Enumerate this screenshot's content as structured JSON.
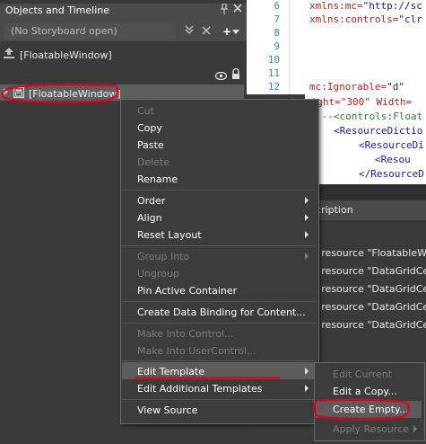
{
  "panel": {
    "title": "Objects and Timeline",
    "storyboard_placeholder": "(No Storyboard open)",
    "scope_label": "[FloatableWindow]",
    "tree_item": "[FloatableWindow]"
  },
  "editor": {
    "line_numbers": [
      "6",
      "7",
      "8",
      "9",
      "10",
      "11",
      "12"
    ],
    "lines": [
      {
        "a": "xmlns:mc=",
        "b": "\"http://sc"
      },
      {
        "a": "xmlns:controls=",
        "b": "\"clr"
      },
      {
        "a": "",
        "b": ""
      },
      {
        "a": "",
        "b": ""
      },
      {
        "a": "",
        "b": ""
      },
      {
        "a": "",
        "b": ""
      },
      {
        "a": "mc:Ignorable=",
        "b": "\"d\""
      }
    ],
    "lines2": [
      {
        "t": "eight=\"300\" Width=",
        "k": "attr"
      },
      {
        "t": "!--<controls:Float",
        "k": "comment"
      },
      {
        "t": "<ResourceDictio",
        "k": "tag"
      },
      {
        "t": "<ResourceDi",
        "k": "tag"
      },
      {
        "t": "<Resou",
        "k": "tag"
      },
      {
        "t": "</ResourceD",
        "k": "tag"
      }
    ]
  },
  "resources": {
    "header": "cription",
    "rows": [
      "e resource \"FloatableWi",
      "e resource \"DataGridCell",
      "e resource \"DataGridCell",
      "e resource \"DataGridCell",
      "e resource \"DataGridCell"
    ]
  },
  "menu": {
    "cut": "Cut",
    "copy": "Copy",
    "paste": "Paste",
    "delete": "Delete",
    "rename": "Rename",
    "order": "Order",
    "align": "Align",
    "reset_layout": "Reset Layout",
    "group_into": "Group Into",
    "ungroup": "Ungroup",
    "pin_active": "Pin Active Container",
    "create_binding": "Create Data Binding for Content...",
    "make_into_control": "Make Into Control...",
    "make_into_usercontrol": "Make Into UserControl...",
    "edit_template": "Edit Template",
    "edit_additional": "Edit Additional Templates",
    "view_source": "View Source"
  },
  "submenu": {
    "edit_current": "Edit Current",
    "edit_copy": "Edit a Copy...",
    "create_empty": "Create Empty...",
    "apply_resource": "Apply Resource"
  },
  "colors": {
    "annotation_red": "#e0001a",
    "menu_bg": "#3c3c3c",
    "highlight": "#5c5c5c"
  }
}
